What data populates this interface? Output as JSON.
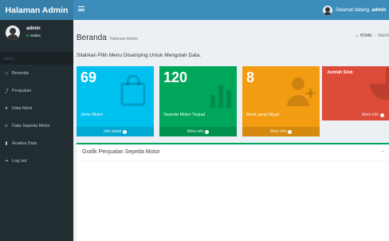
{
  "app": {
    "title": "Halaman Admin"
  },
  "navbar": {
    "welcome_prefix": "Selamat datang,",
    "welcome_user": "admin"
  },
  "user_panel": {
    "name": "admin",
    "status": "Online"
  },
  "sidebar": {
    "header": "MENU",
    "items": [
      {
        "label": "Beranda",
        "icon": "home-icon",
        "glyph": "⌂"
      },
      {
        "label": "Penjualan",
        "icon": "line-chart-icon",
        "glyph": "⤴"
      },
      {
        "label": "Data Merk",
        "icon": "circle-icon",
        "glyph": "●"
      },
      {
        "label": "Data Sepeda Motor",
        "icon": "motorcycle-icon",
        "glyph": "∞"
      },
      {
        "label": "Analisa Data",
        "icon": "document-icon",
        "glyph": "▮"
      },
      {
        "label": "Log out",
        "icon": "logout-icon",
        "glyph": "⇥"
      }
    ]
  },
  "page": {
    "title": "Beranda",
    "subtitle": "Halaman Admin",
    "breadcrumb": {
      "home": "HOME",
      "current": "BERA"
    },
    "instruction": "Silahkan Pilih Menu Disamping Untuk Mengolah Data."
  },
  "stats": [
    {
      "value": "69",
      "label": "Jenis Motor",
      "footer": "Info detail",
      "color": "#00c0ef",
      "icon": "shopping-bag-icon"
    },
    {
      "value": "120",
      "label": "Sepeda Motor Terjual",
      "footer": "More info",
      "color": "#00a65a",
      "icon": "bar-chart-icon"
    },
    {
      "value": "8",
      "label": "Merk yang Dijual",
      "footer": "More info",
      "color": "#f39c12",
      "icon": "user-plus-icon"
    },
    {
      "value": "",
      "label": "Jumlah Stok",
      "footer": "More info",
      "color": "#dd4b39",
      "icon": "pie-chart-icon"
    }
  ],
  "chart_panel": {
    "title": "Grafik Penjualan Sepeda Motor",
    "collapse_glyph": "−"
  }
}
